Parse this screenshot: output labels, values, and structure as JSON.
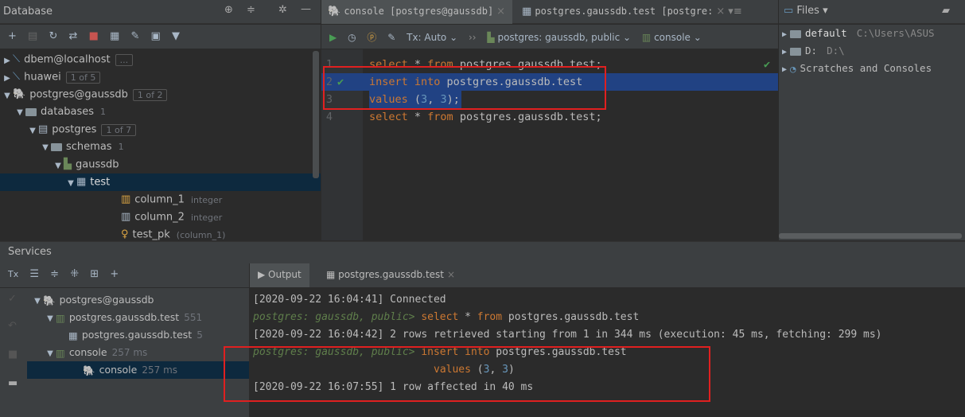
{
  "db_panel": {
    "title": "Database",
    "tree": [
      {
        "label": "dbem@localhost",
        "badge": "..."
      },
      {
        "label": "huawei",
        "badge": "1 of 5"
      },
      {
        "label": "postgres@gaussdb",
        "badge": "1 of 2"
      },
      {
        "label": "databases",
        "badge": "1"
      },
      {
        "label": "postgres",
        "badge": "1 of 7"
      },
      {
        "label": "schemas",
        "badge": "1"
      },
      {
        "label": "gaussdb"
      },
      {
        "label": "test"
      },
      {
        "label": "column_1",
        "type": "integer"
      },
      {
        "label": "column_2",
        "type": "integer"
      },
      {
        "label": "test_pk",
        "type": "(column_1)"
      }
    ]
  },
  "editor": {
    "tabs": [
      {
        "label": "console [postgres@gaussdb]"
      },
      {
        "label": "postgres.gaussdb.test [postgre:"
      }
    ],
    "tx": "Tx: Auto",
    "schema": "postgres: gaussdb, public",
    "console": "console",
    "lines": [
      {
        "num": "1",
        "kw1": "select",
        "rest1": " * ",
        "kw2": "from",
        "rest2": " postgres.gaussdb.test;"
      },
      {
        "num": "2",
        "kw1": "insert into",
        "rest1": " postgres.gaussdb.test"
      },
      {
        "num": "3",
        "kw1": "values",
        "rest1": " (",
        "n1": "3",
        ", ": "",
        "n2": "3",
        "rest2": ");"
      },
      {
        "num": "4",
        "kw1": "select",
        "rest1": " * ",
        "kw2": "from",
        "rest2": " postgres.gaussdb.test;"
      }
    ]
  },
  "files": {
    "title": "Files",
    "items": [
      {
        "label": "default",
        "path": "C:\\Users\\ASUS"
      },
      {
        "label": "D:",
        "path": "D:\\"
      },
      {
        "label": "Scratches and Consoles"
      }
    ]
  },
  "services": {
    "title": "Services",
    "tree": [
      {
        "label": "postgres@gaussdb"
      },
      {
        "label": "postgres.gaussdb.test",
        "extra": "551"
      },
      {
        "label": "postgres.gaussdb.test",
        "extra": "5"
      },
      {
        "label": "console",
        "extra": "257 ms"
      },
      {
        "label": "console",
        "extra": "257 ms"
      }
    ]
  },
  "output": {
    "tabs": [
      "Output",
      "postgres.gaussdb.test"
    ],
    "lines": [
      {
        "text": "[2020-09-22 16:04:41] Connected"
      },
      {
        "prompt": "postgres: gaussdb, public>",
        "kw1": "select",
        "rest1": " * ",
        "kw2": "from",
        "rest2": " postgres.gaussdb.test"
      },
      {
        "text": "[2020-09-22 16:04:42] 2 rows retrieved starting from 1 in 344 ms (execution: 45 ms, fetching: 299 ms)"
      },
      {
        "prompt": "postgres: gaussdb, public>",
        "kw1": "insert into",
        "rest1": " postgres.gaussdb.test"
      },
      {
        "kw1": "values",
        "rest1": " (",
        "n1": "3",
        "mid": ", ",
        "n2": "3",
        "rest2": ")"
      },
      {
        "text": "[2020-09-22 16:07:55] 1 row affected in 40 ms"
      }
    ]
  }
}
